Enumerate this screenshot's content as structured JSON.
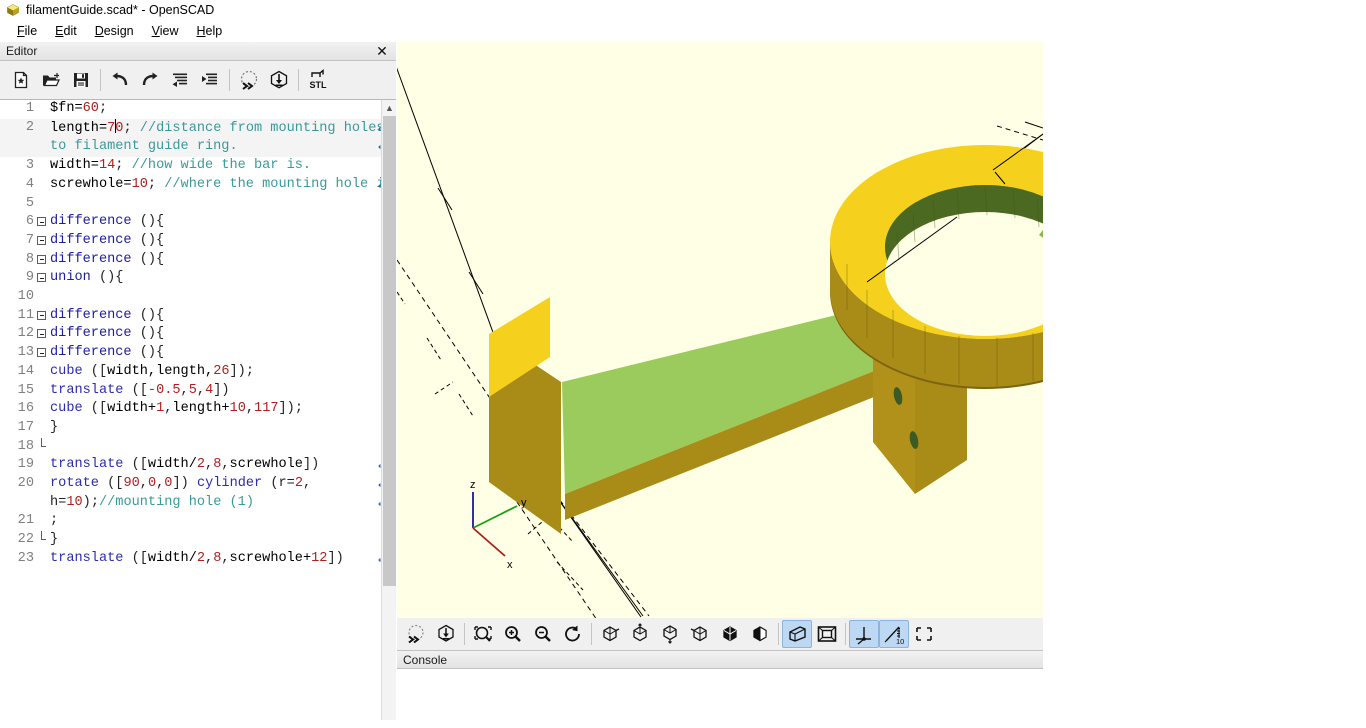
{
  "window": {
    "title": "filamentGuide.scad* - OpenSCAD",
    "icon": "openscad-logo-icon"
  },
  "menubar": {
    "items": [
      {
        "label": "File",
        "mnemonic": "F"
      },
      {
        "label": "Edit",
        "mnemonic": "E"
      },
      {
        "label": "Design",
        "mnemonic": "D"
      },
      {
        "label": "View",
        "mnemonic": "V"
      },
      {
        "label": "Help",
        "mnemonic": "H"
      }
    ]
  },
  "editor_dock": {
    "title": "Editor",
    "close_label": "✕",
    "toolbar": [
      {
        "name": "new-file-button",
        "tooltip": "New"
      },
      {
        "name": "open-file-button",
        "tooltip": "Open"
      },
      {
        "name": "save-file-button",
        "tooltip": "Save"
      },
      {
        "name": "undo-button",
        "tooltip": "Undo"
      },
      {
        "name": "redo-button",
        "tooltip": "Redo"
      },
      {
        "name": "unindent-button",
        "tooltip": "Unindent"
      },
      {
        "name": "indent-button",
        "tooltip": "Indent"
      },
      {
        "name": "preview-button",
        "tooltip": "Preview"
      },
      {
        "name": "render-button",
        "tooltip": "Render"
      },
      {
        "name": "export-stl-button",
        "tooltip": "Export as STL",
        "label": "STL"
      }
    ]
  },
  "code": {
    "lines": [
      {
        "n": "1",
        "fold": "none",
        "current": false,
        "wrap": 0,
        "tokens": [
          [
            "plain",
            "$fn="
          ],
          [
            "num",
            "60"
          ],
          [
            "punc",
            ";"
          ]
        ]
      },
      {
        "n": "2",
        "fold": "none",
        "current": true,
        "wrap": 2,
        "tokens": [
          [
            "plain",
            "length="
          ],
          [
            "num",
            "7"
          ],
          [
            "caret",
            ""
          ],
          [
            "num",
            "0"
          ],
          [
            "punc",
            "; "
          ],
          [
            "com",
            "//distance from mounting holes to filament guide ring."
          ]
        ]
      },
      {
        "n": "3",
        "fold": "none",
        "current": false,
        "wrap": 0,
        "tokens": [
          [
            "plain",
            "width="
          ],
          [
            "num",
            "14"
          ],
          [
            "punc",
            "; "
          ],
          [
            "com",
            "//how wide the bar is."
          ]
        ]
      },
      {
        "n": "4",
        "fold": "none",
        "current": false,
        "wrap": 1,
        "tokens": [
          [
            "plain",
            "screwhole="
          ],
          [
            "num",
            "10"
          ],
          [
            "punc",
            "; "
          ],
          [
            "com",
            "//where the mounting hole is"
          ]
        ]
      },
      {
        "n": "5",
        "fold": "none",
        "current": false,
        "wrap": 0,
        "tokens": []
      },
      {
        "n": "6",
        "fold": "box",
        "current": false,
        "wrap": 0,
        "tokens": [
          [
            "kw",
            "difference"
          ],
          [
            "punc",
            " (){"
          ]
        ]
      },
      {
        "n": "7",
        "fold": "box",
        "current": false,
        "wrap": 0,
        "tokens": [
          [
            "kw",
            "difference"
          ],
          [
            "punc",
            " (){"
          ]
        ]
      },
      {
        "n": "8",
        "fold": "box",
        "current": false,
        "wrap": 0,
        "tokens": [
          [
            "kw",
            "difference"
          ],
          [
            "punc",
            " (){"
          ]
        ]
      },
      {
        "n": "9",
        "fold": "box",
        "current": false,
        "wrap": 0,
        "tokens": [
          [
            "kw",
            "union"
          ],
          [
            "punc",
            " (){"
          ]
        ]
      },
      {
        "n": "10",
        "fold": "line",
        "current": false,
        "wrap": 0,
        "tokens": []
      },
      {
        "n": "11",
        "fold": "box",
        "current": false,
        "wrap": 0,
        "tokens": [
          [
            "kw",
            "difference"
          ],
          [
            "punc",
            " (){"
          ]
        ]
      },
      {
        "n": "12",
        "fold": "box",
        "current": false,
        "wrap": 0,
        "tokens": [
          [
            "kw",
            "difference"
          ],
          [
            "punc",
            " (){"
          ]
        ]
      },
      {
        "n": "13",
        "fold": "box",
        "current": false,
        "wrap": 0,
        "tokens": [
          [
            "kw",
            "difference"
          ],
          [
            "punc",
            " (){"
          ]
        ]
      },
      {
        "n": "14",
        "fold": "line",
        "current": false,
        "wrap": 0,
        "tokens": [
          [
            "fn",
            "cube"
          ],
          [
            "punc",
            " (["
          ],
          [
            "plain",
            "width,length,"
          ],
          [
            "num",
            "26"
          ],
          [
            "punc",
            "]);"
          ]
        ]
      },
      {
        "n": "15",
        "fold": "line",
        "current": false,
        "wrap": 0,
        "tokens": [
          [
            "fn",
            "translate"
          ],
          [
            "punc",
            " (["
          ],
          [
            "num",
            "-0.5"
          ],
          [
            "punc",
            ","
          ],
          [
            "num",
            "5"
          ],
          [
            "punc",
            ","
          ],
          [
            "num",
            "4"
          ],
          [
            "punc",
            "])"
          ]
        ]
      },
      {
        "n": "16",
        "fold": "line",
        "current": false,
        "wrap": 0,
        "tokens": [
          [
            "fn",
            "cube"
          ],
          [
            "punc",
            " (["
          ],
          [
            "plain",
            "width+"
          ],
          [
            "num",
            "1"
          ],
          [
            "punc",
            ","
          ],
          [
            "plain",
            "length+"
          ],
          [
            "num",
            "10"
          ],
          [
            "punc",
            ","
          ],
          [
            "num",
            "117"
          ],
          [
            "punc",
            "]);"
          ]
        ]
      },
      {
        "n": "17",
        "fold": "line",
        "current": false,
        "wrap": 0,
        "tokens": [
          [
            "punc",
            "}"
          ]
        ]
      },
      {
        "n": "18",
        "fold": "end",
        "current": false,
        "wrap": 0,
        "tokens": []
      },
      {
        "n": "19",
        "fold": "line",
        "current": false,
        "wrap": 1,
        "tokens": [
          [
            "fn",
            "translate"
          ],
          [
            "punc",
            " (["
          ],
          [
            "plain",
            "width/"
          ],
          [
            "num",
            "2"
          ],
          [
            "punc",
            ","
          ],
          [
            "num",
            "8"
          ],
          [
            "punc",
            ","
          ],
          [
            "plain",
            "screwhole"
          ],
          [
            "punc",
            "])"
          ]
        ]
      },
      {
        "n": "20",
        "fold": "line",
        "current": false,
        "wrap": 2,
        "tokens": [
          [
            "fn",
            "rotate"
          ],
          [
            "punc",
            " (["
          ],
          [
            "num",
            "90"
          ],
          [
            "punc",
            ","
          ],
          [
            "num",
            "0"
          ],
          [
            "punc",
            ","
          ],
          [
            "num",
            "0"
          ],
          [
            "punc",
            "]) "
          ],
          [
            "fn",
            "cylinder"
          ],
          [
            "punc",
            " (r="
          ],
          [
            "num",
            "2"
          ],
          [
            "punc",
            ", h="
          ],
          [
            "num",
            "10"
          ],
          [
            "punc",
            ");"
          ],
          [
            "com",
            "//mounting hole (1)"
          ]
        ]
      },
      {
        "n": "21",
        "fold": "line",
        "current": false,
        "wrap": 0,
        "tokens": [
          [
            "punc",
            ";"
          ]
        ]
      },
      {
        "n": "22",
        "fold": "end",
        "current": false,
        "wrap": 0,
        "tokens": [
          [
            "punc",
            "}"
          ]
        ]
      },
      {
        "n": "23",
        "fold": "line",
        "current": false,
        "wrap": 1,
        "tokens": [
          [
            "fn",
            "translate"
          ],
          [
            "punc",
            " (["
          ],
          [
            "plain",
            "width/"
          ],
          [
            "num",
            "2"
          ],
          [
            "punc",
            ","
          ],
          [
            "num",
            "8"
          ],
          [
            "punc",
            ","
          ],
          [
            "plain",
            "screwhole+"
          ],
          [
            "num",
            "12"
          ],
          [
            "punc",
            "])"
          ]
        ]
      }
    ],
    "wrap_marker_glyph": "↵"
  },
  "viewport": {
    "background_color": "#ffffe5",
    "axis_labels": {
      "x": "x",
      "y": "y",
      "z": "z"
    },
    "axis_colors": {
      "x": "#aa2020",
      "y": "#18a018",
      "z": "#1a1a9a"
    },
    "model_colors": {
      "top_green": "#9acb5c",
      "top_yellow": "#f5d11e",
      "side_olive": "#a98b18",
      "side_dark": "#7d6410",
      "inner_green": "#7fae3e",
      "inner_dark": "#46581d"
    }
  },
  "view_toolbar": {
    "buttons": [
      {
        "name": "preview-button",
        "active": false,
        "tooltip": "Preview"
      },
      {
        "name": "render-button",
        "active": false,
        "tooltip": "Render"
      },
      {
        "name": "zoom-all-button",
        "active": false,
        "tooltip": "View All"
      },
      {
        "name": "zoom-in-button",
        "active": false,
        "tooltip": "Zoom In"
      },
      {
        "name": "zoom-out-button",
        "active": false,
        "tooltip": "Zoom Out"
      },
      {
        "name": "reset-view-button",
        "active": false,
        "tooltip": "Reset View"
      },
      {
        "name": "view-right-button",
        "active": false,
        "tooltip": "Right View"
      },
      {
        "name": "view-top-button",
        "active": false,
        "tooltip": "Top View"
      },
      {
        "name": "view-bottom-button",
        "active": false,
        "tooltip": "Bottom View"
      },
      {
        "name": "view-left-button",
        "active": false,
        "tooltip": "Left View"
      },
      {
        "name": "view-front-button",
        "active": false,
        "tooltip": "Front View"
      },
      {
        "name": "view-back-button",
        "active": false,
        "tooltip": "Back View"
      },
      {
        "name": "perspective-view-button",
        "active": true,
        "tooltip": "Perspective"
      },
      {
        "name": "orthogonal-view-button",
        "active": false,
        "tooltip": "Orthogonal"
      },
      {
        "name": "show-axes-button",
        "active": true,
        "tooltip": "Show Axes"
      },
      {
        "name": "show-scale-markers-button",
        "active": true,
        "tooltip": "Show Scale Markers",
        "label": "10"
      },
      {
        "name": "show-crosshairs-button",
        "active": false,
        "tooltip": "Show Crosshairs"
      }
    ]
  },
  "console_dock": {
    "title": "Console"
  }
}
